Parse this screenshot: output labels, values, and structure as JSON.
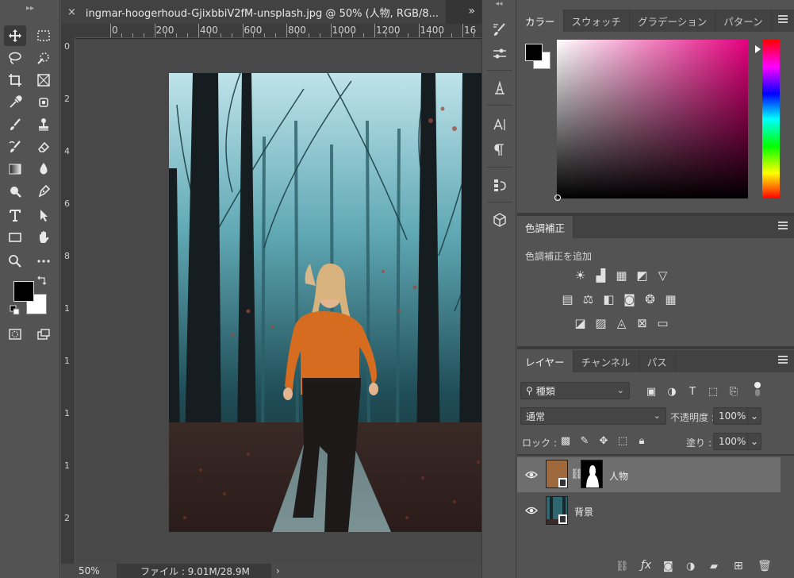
{
  "document": {
    "tab_title": "ingmar-hoogerhoud-GjixbbiV2fM-unsplash.jpg @ 50% (人物, RGB/8...",
    "close_glyph": "×",
    "more_glyph": "»",
    "ruler_h": [
      "0",
      "200",
      "400",
      "600",
      "800",
      "1000",
      "1200",
      "1400",
      "16"
    ],
    "ruler_v": [
      "0",
      "2",
      "4",
      "6",
      "8",
      "1",
      "1",
      "1",
      "1",
      "2"
    ],
    "zoom": "50%",
    "file_info": "ファイル : 9.01M/28.9M",
    "status_arrow": "›"
  },
  "color_panel": {
    "tabs": [
      "カラー",
      "スウォッチ",
      "グラデーション",
      "パターン"
    ],
    "hue_color": "#e6007e"
  },
  "adjustments_panel": {
    "tab": "色調補正",
    "add_label": "色調補正を追加"
  },
  "layers_panel": {
    "tabs": [
      "レイヤー",
      "チャンネル",
      "パス"
    ],
    "filter_label": "種類",
    "blend_mode": "通常",
    "opacity_label": "不透明度 :",
    "opacity_value": "100%",
    "lock_label": "ロック :",
    "fill_label": "塗り :",
    "fill_value": "100%",
    "layers": [
      {
        "name": "人物",
        "selected": true
      },
      {
        "name": "背景",
        "selected": false
      }
    ]
  },
  "colors": {
    "foreground": "#000000",
    "background": "#ffffff"
  }
}
